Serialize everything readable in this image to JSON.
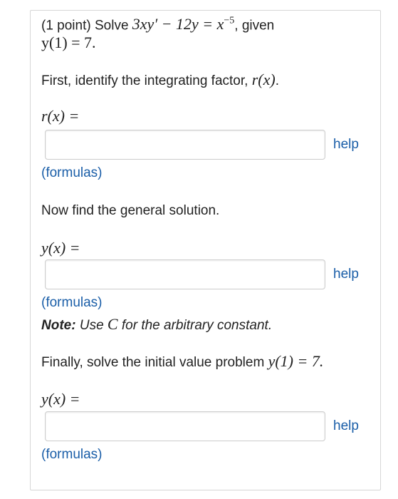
{
  "problem": {
    "prefix": "(1 point) Solve ",
    "equation": "3xy′ − 12y = x",
    "exponent": "−5",
    "given": ", given",
    "initial": "y(1) = 7."
  },
  "part1": {
    "instruction": "First, identify the integrating factor, ",
    "fn": "r(x)",
    "period": ".",
    "label": "r(x) =",
    "input_value": "",
    "help_label": "help",
    "formulas_label": "(formulas)"
  },
  "part2": {
    "instruction": "Now find the general solution.",
    "label": "y(x) =",
    "input_value": "",
    "help_label": "help",
    "formulas_label": "(formulas)",
    "note_bold": "Note:",
    "note_pre": " Use ",
    "note_var": "C",
    "note_post": " for the arbitrary constant."
  },
  "part3": {
    "instruction": "Finally, solve the initial value problem ",
    "ivp": "y(1) = 7.",
    "label": "y(x) =",
    "input_value": "",
    "help_label": "help",
    "formulas_label": "(formulas)"
  }
}
